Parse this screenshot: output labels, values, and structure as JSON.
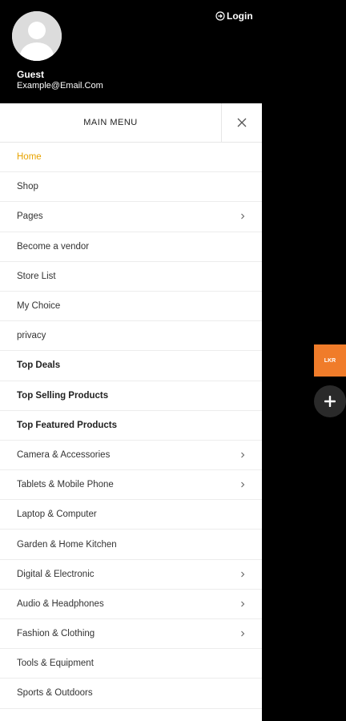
{
  "header": {
    "login_label": "Login",
    "user_name": "Guest",
    "user_email": "Example@Email.Com"
  },
  "menu": {
    "title": "MAIN MENU",
    "items": [
      {
        "label": "Home",
        "has_submenu": false,
        "style": "active"
      },
      {
        "label": "Shop",
        "has_submenu": false,
        "style": "normal"
      },
      {
        "label": "Pages",
        "has_submenu": true,
        "style": "normal"
      },
      {
        "label": "Become a vendor",
        "has_submenu": false,
        "style": "normal"
      },
      {
        "label": "Store List",
        "has_submenu": false,
        "style": "normal"
      },
      {
        "label": "My Choice",
        "has_submenu": false,
        "style": "normal"
      },
      {
        "label": "privacy",
        "has_submenu": false,
        "style": "normal"
      },
      {
        "label": "Top Deals",
        "has_submenu": false,
        "style": "bold"
      },
      {
        "label": "Top Selling Products",
        "has_submenu": false,
        "style": "bold"
      },
      {
        "label": "Top Featured Products",
        "has_submenu": false,
        "style": "bold"
      },
      {
        "label": "Camera & Accessories",
        "has_submenu": true,
        "style": "normal"
      },
      {
        "label": "Tablets & Mobile Phone",
        "has_submenu": true,
        "style": "normal"
      },
      {
        "label": "Laptop & Computer",
        "has_submenu": false,
        "style": "normal"
      },
      {
        "label": "Garden & Home Kitchen",
        "has_submenu": false,
        "style": "normal"
      },
      {
        "label": "Digital & Electronic",
        "has_submenu": true,
        "style": "normal"
      },
      {
        "label": "Audio & Headphones",
        "has_submenu": true,
        "style": "normal"
      },
      {
        "label": "Fashion & Clothing",
        "has_submenu": true,
        "style": "normal"
      },
      {
        "label": "Tools & Equipment",
        "has_submenu": false,
        "style": "normal"
      },
      {
        "label": "Sports & Outdoors",
        "has_submenu": false,
        "style": "normal"
      }
    ]
  },
  "side_tab": {
    "label": "LKR"
  },
  "colors": {
    "accent_active": "#e8a300",
    "side_tab_bg": "#f07c2a",
    "fab_bg": "#2a2a2a"
  },
  "icons": {
    "login": "login-arrow-icon",
    "close": "close-icon",
    "submenu": "chevron-right-icon",
    "fab": "plus-icon"
  }
}
